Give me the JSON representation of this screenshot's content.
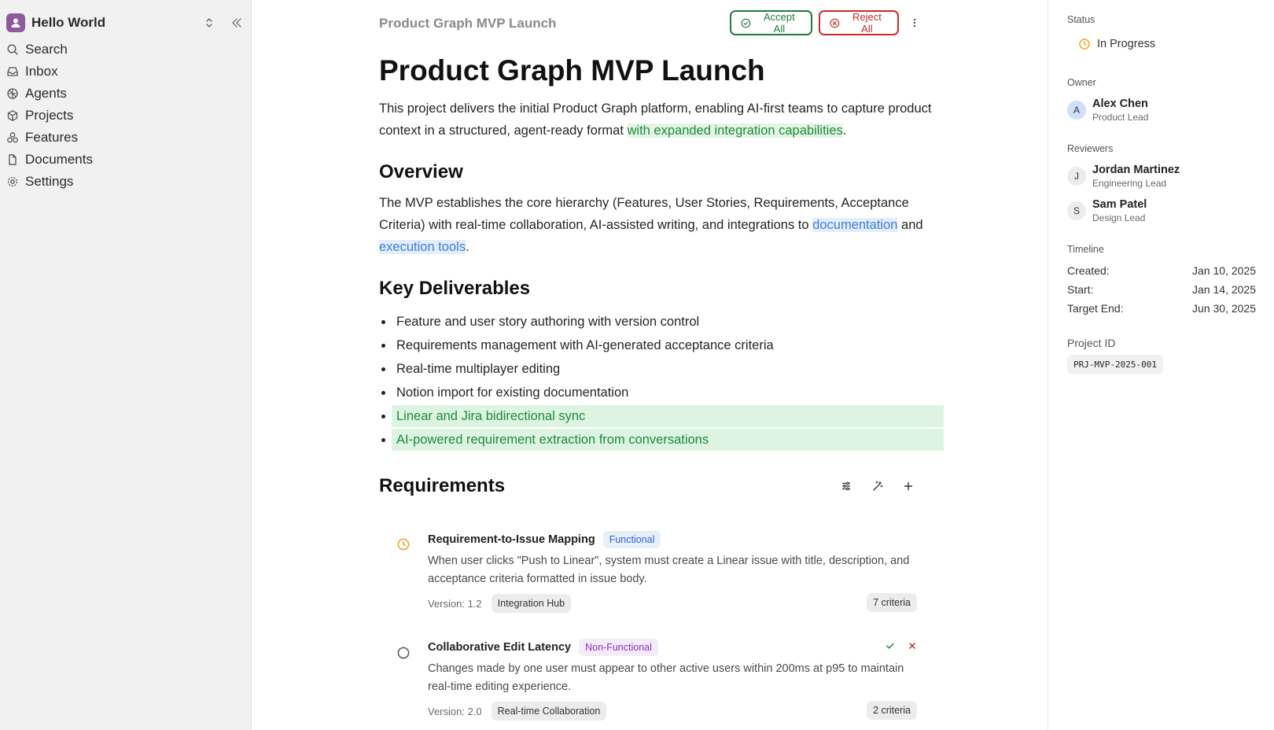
{
  "sidebar": {
    "workspace_name": "Hello World",
    "items": [
      {
        "label": "Search",
        "icon": "search-icon"
      },
      {
        "label": "Inbox",
        "icon": "inbox-icon"
      },
      {
        "label": "Agents",
        "icon": "agents-icon"
      },
      {
        "label": "Projects",
        "icon": "box-icon"
      },
      {
        "label": "Features",
        "icon": "features-icon"
      },
      {
        "label": "Documents",
        "icon": "document-icon"
      },
      {
        "label": "Settings",
        "icon": "gear-icon"
      }
    ]
  },
  "header": {
    "breadcrumb_title": "Product Graph MVP Launch",
    "accept_label": "Accept All",
    "reject_label": "Reject All"
  },
  "doc": {
    "title": "Product Graph MVP Launch",
    "intro": "This project delivers the initial Product Graph platform, enabling AI-first teams to capture product context in a structured, agent-ready format",
    "intro_added": "with expanded integration capabilities",
    "intro_end": ".",
    "overview_heading": "Overview",
    "overview_text": "The MVP establishes the core hierarchy (Features, User Stories, Requirements, Acceptance Criteria) with real-time collaboration, AI-assisted writing, and integrations to",
    "overview_link1": "documentation",
    "overview_and": "and",
    "overview_link2": "execution tools",
    "overview_end": ".",
    "deliverables_heading": "Key Deliverables",
    "deliverables": [
      "Feature and user story authoring with version control",
      "Requirements management with AI-generated acceptance criteria",
      "Real-time multiplayer editing",
      "Notion import for existing documentation",
      "Linear and Jira bidirectional sync",
      "AI-powered requirement extraction from conversations"
    ],
    "requirements_heading": "Requirements"
  },
  "requirements": [
    {
      "title": "Requirement-to-Issue Mapping",
      "tag": "Functional",
      "description": "When user clicks \"Push to Linear\", system must create a Linear issue with title, description, and acceptance criteria formatted in issue body.",
      "version": "Version: 1.2",
      "feature": "Integration Hub",
      "criteria": "7 criteria",
      "status": "in-progress"
    },
    {
      "title": "Collaborative Edit Latency",
      "tag": "Non-Functional",
      "description": "Changes made by one user must appear to other active users within 200ms at p95 to maintain real-time editing experience.",
      "version": "Version: 2.0",
      "feature": "Real-time Collaboration",
      "criteria": "2 criteria",
      "status": "not-started"
    }
  ],
  "panel": {
    "status_label": "Status",
    "status_value": "In Progress",
    "owner_label": "Owner",
    "owner": {
      "initial": "A",
      "name": "Alex Chen",
      "role": "Product Lead"
    },
    "reviewers_label": "Reviewers",
    "reviewers": [
      {
        "initial": "J",
        "name": "Jordan Martinez",
        "role": "Engineering Lead"
      },
      {
        "initial": "S",
        "name": "Sam Patel",
        "role": "Design Lead"
      }
    ],
    "timeline_label": "Timeline",
    "timeline": [
      {
        "label": "Created:",
        "value": "Jan 10, 2025"
      },
      {
        "label": "Start:",
        "value": "Jan 14, 2025"
      },
      {
        "label": "Target End:",
        "value": "Jun 30, 2025"
      }
    ],
    "project_id_label": "Project ID",
    "project_id": "PRJ-MVP-2025-001"
  },
  "colors": {
    "accept": "#1f7a3e",
    "reject": "#c92a2a",
    "inserted_text": "#1f8a3a",
    "link": "#3b7fd9",
    "in_progress": "#e6a817"
  }
}
